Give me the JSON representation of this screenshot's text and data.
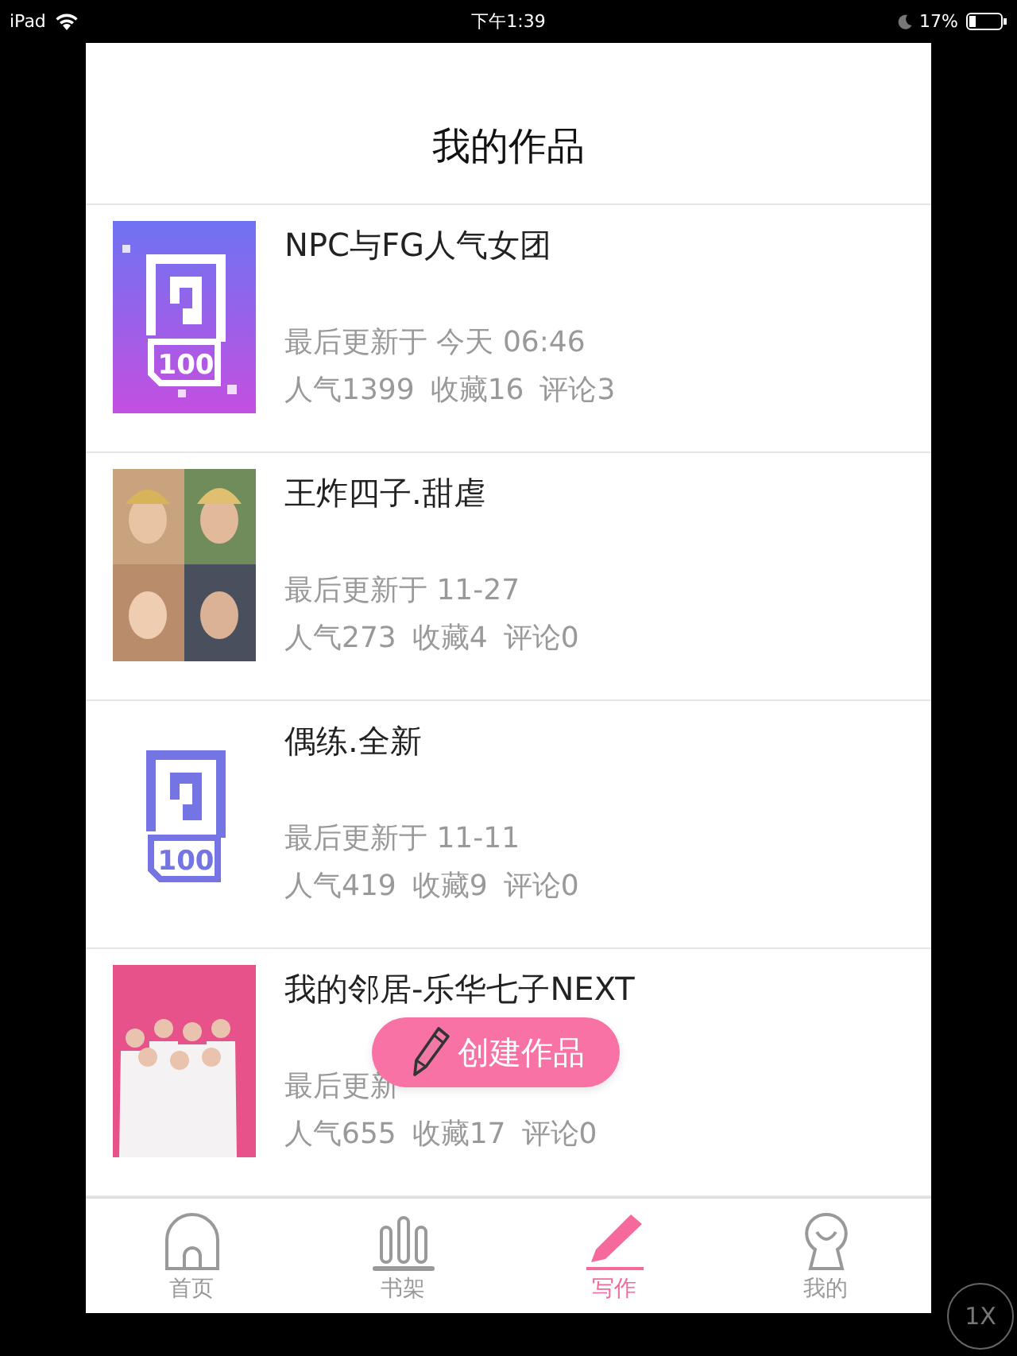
{
  "status_bar": {
    "device": "iPad",
    "time": "下午1:39",
    "battery": "17%"
  },
  "header": {
    "title": "我的作品"
  },
  "works": [
    {
      "title": "NPC与FG人气女团",
      "updated": "最后更新于 今天 06:46",
      "popularity": "人气1399",
      "favorites": "收藏16",
      "comments": "评论3",
      "thumbnail": {
        "kind": "gradient-logo",
        "logo_text": "100"
      }
    },
    {
      "title": "王炸四子.甜虐",
      "updated": "最后更新于 11-27",
      "popularity": "人气273",
      "favorites": "收藏4",
      "comments": "评论0"
    },
    {
      "title": "偶练.全新",
      "updated": "最后更新于 11-11",
      "popularity": "人气419",
      "favorites": "收藏9",
      "comments": "评论0",
      "thumbnail": {
        "kind": "logo",
        "logo_text": "100"
      }
    },
    {
      "title": "我的邻居-乐华七子NEXT",
      "updated": "最后更新",
      "popularity": "人气655",
      "favorites": "收藏17",
      "comments": "评论0"
    }
  ],
  "create_button": {
    "label": "创建作品"
  },
  "tabs": [
    {
      "kind": "home",
      "label": "首页",
      "selected": false
    },
    {
      "kind": "shelf",
      "label": "书架",
      "selected": false
    },
    {
      "kind": "write",
      "label": "写作",
      "selected": true
    },
    {
      "kind": "me",
      "label": "我的",
      "selected": false
    }
  ],
  "zoom_button": {
    "label": "1X"
  }
}
